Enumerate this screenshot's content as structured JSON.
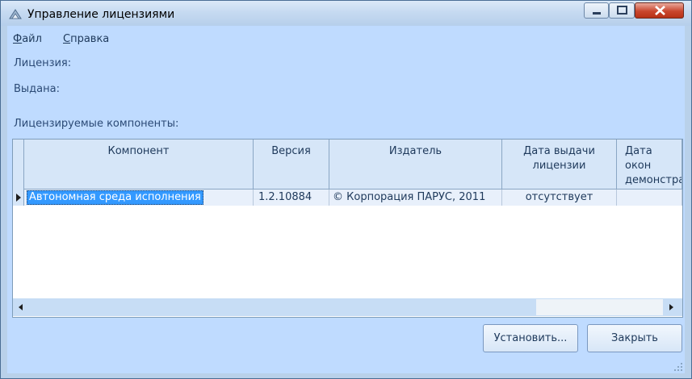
{
  "window": {
    "title": "Управление лицензиями"
  },
  "menu": [
    {
      "accel": "Ф",
      "rest": "айл"
    },
    {
      "accel": "С",
      "rest": "правка"
    }
  ],
  "labels": {
    "license": "Лицензия:",
    "issued": "Выдана:",
    "components": "Лицензируемые компоненты:"
  },
  "grid": {
    "columns": [
      "Компонент",
      "Версия",
      "Издатель",
      "Дата выдачи лицензии",
      "Дата окон демонстрац режи"
    ],
    "rows": [
      {
        "component": "Автономная среда исполнения",
        "version": "1.2.10884",
        "publisher": "© Корпорация ПАРУС, 2011",
        "issue_date": "отсутствует",
        "demo_end": ""
      }
    ]
  },
  "buttons": {
    "install": "Установить...",
    "close": "Закрыть"
  },
  "colors": {
    "client_bg": "#bfdbff",
    "selection": "#3399ff",
    "close_button": "#c9462e"
  }
}
